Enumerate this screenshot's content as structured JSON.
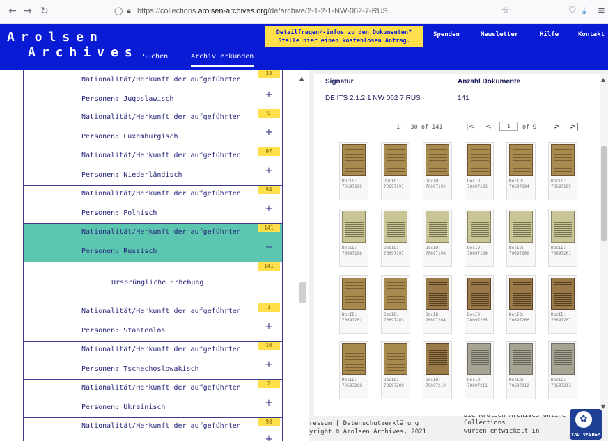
{
  "browser": {
    "url_prefix": "https://collections.",
    "url_domain": "arolsen-archives.org",
    "url_path": "/de/archive/2-1-2-1-NW-062-7-RUS"
  },
  "header": {
    "logo_line1": "Arolsen",
    "logo_line2": "Archives",
    "tab_suchen": "Suchen",
    "tab_archiv": "Archiv erkunden",
    "info_line1": "Detailfragen/-infos zu den Dokumenten?",
    "info_line2": "Stelle hier einen kostenlosen Antrag.",
    "nav_spenden": "Spenden",
    "nav_newsletter": "Newsletter",
    "nav_hilfe": "Hilfe",
    "nav_kontakt": "Kontakt"
  },
  "tree": {
    "rows": [
      {
        "line1": "Nationalität/Herkunft der aufgeführten",
        "line2": "Personen: Jugoslawisch",
        "count": "33",
        "toggle": "+"
      },
      {
        "line1": "Nationalität/Herkunft der aufgeführten",
        "line2": "Personen: Luxemburgisch",
        "count": "9",
        "toggle": "+"
      },
      {
        "line1": "Nationalität/Herkunft der aufgeführten",
        "line2": "Personen: Niederländisch",
        "count": "97",
        "toggle": "+"
      },
      {
        "line1": "Nationalität/Herkunft der aufgeführten",
        "line2": "Personen: Polnisch",
        "count": "94",
        "toggle": "+"
      },
      {
        "line1": "Nationalität/Herkunft der aufgeführten",
        "line2": "Personen: Russisch",
        "count": "141",
        "toggle": "−"
      },
      {
        "line1": "Nationalität/Herkunft der aufgeführten",
        "line2": "Personen: Staatenlos",
        "count": "1",
        "toggle": "+"
      },
      {
        "line1": "Nationalität/Herkunft der aufgeführten",
        "line2": "Personen: Tschechoslowakisch",
        "count": "16",
        "toggle": "+"
      },
      {
        "line1": "Nationalität/Herkunft der aufgeführten",
        "line2": "Personen: Ukrainisch",
        "count": "2",
        "toggle": "+"
      },
      {
        "line1": "Nationalität/Herkunft der aufgeführten",
        "line2": "",
        "count": "98",
        "toggle": "+"
      }
    ],
    "sub": {
      "label": "Ursprüngliche Erhebung",
      "count": "141"
    }
  },
  "detail": {
    "signatur_head": "Signatur",
    "anzahl_head": "Anzahl Dokumente",
    "signatur_val": "DE ITS 2.1.2.1 NW 062 7 RUS",
    "anzahl_val": "141",
    "range": "1 - 30 of 141",
    "page": "1",
    "of_pages": "of 9",
    "doc_prefix": "DocID:",
    "doc_ids": [
      "70697190",
      "70697191",
      "70697192",
      "70697193",
      "70697194",
      "70697195",
      "70697196",
      "70697197",
      "70697198",
      "70697199",
      "70697200",
      "70697201",
      "70697202",
      "70697203",
      "70697204",
      "70697205",
      "70697206",
      "70697207",
      "70697208",
      "70697209",
      "70697210",
      "70697211",
      "70697212",
      "70697213"
    ]
  },
  "footer": {
    "impressum": "ressum  |  Datenschutzerklärung",
    "copyright": "yright © Arolsen Archives, 2021",
    "mid_line0": "Die Arolsen Archives Online",
    "mid_line1": "Collections",
    "mid_line2": "wurden entwickelt in",
    "yv": "YAD VASHEM"
  }
}
